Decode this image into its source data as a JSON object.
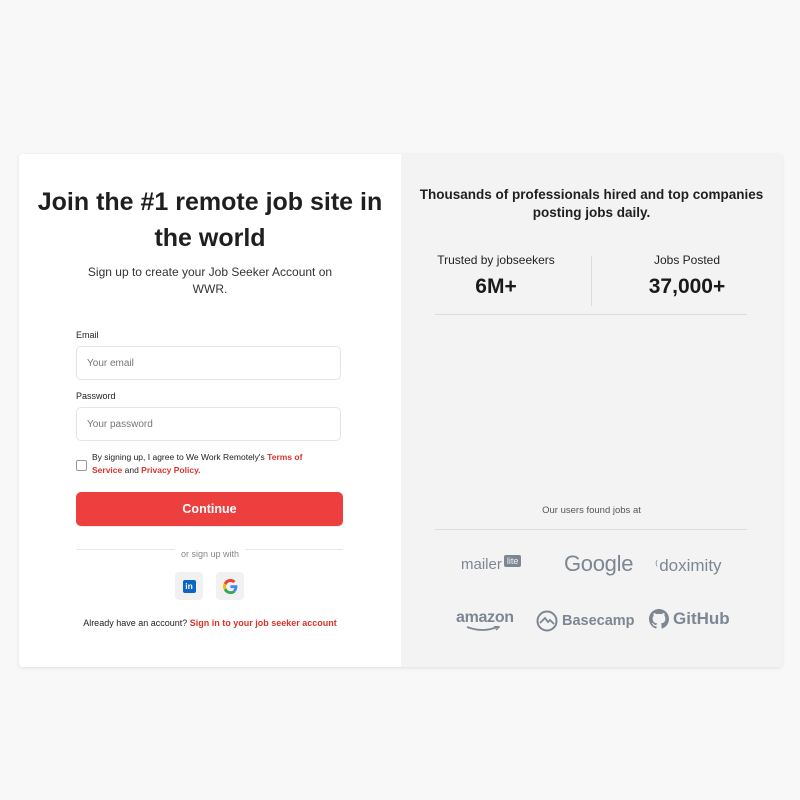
{
  "form": {
    "title": "Join the #1 remote job site in the world",
    "subtitle": "Sign up to create your Job Seeker Account on WWR.",
    "email_label": "Email",
    "email_placeholder": "Your email",
    "password_label": "Password",
    "password_placeholder": "Your password",
    "agree_prefix": "By signing up, I agree to We Work Remotely's ",
    "terms_link": "Terms of Service",
    "agree_and": " and ",
    "privacy_link": "Privacy Policy.",
    "continue_label": "Continue",
    "or_text": "or sign up with",
    "signin_prefix": "Already have an account? ",
    "signin_link": "Sign in to your job seeker account"
  },
  "social": [
    {
      "name": "linkedin",
      "icon": "linkedin-icon",
      "glyph": "in",
      "color": "#0a66c2"
    },
    {
      "name": "google",
      "icon": "google-icon",
      "glyph": "G"
    }
  ],
  "promo": {
    "headline": "Thousands of professionals hired and top companies posting jobs daily.",
    "stats": [
      {
        "label": "Trusted by jobseekers",
        "value": "6M+"
      },
      {
        "label": "Jobs Posted",
        "value": "37,000+"
      }
    ],
    "found_text": "Our users found jobs at",
    "logos": [
      {
        "name": "mailerlite",
        "text": "mailer",
        "badge": "lite"
      },
      {
        "name": "google",
        "text": "Google"
      },
      {
        "name": "doximity",
        "text": "doximity"
      },
      {
        "name": "amazon",
        "text": "amazon"
      },
      {
        "name": "basecamp",
        "text": "Basecamp"
      },
      {
        "name": "github",
        "text": "GitHub"
      }
    ]
  },
  "colors": {
    "accent": "#ee3f3f",
    "link": "#d9342b",
    "panel": "#f3f3f3",
    "logo_gray": "#7d8794"
  }
}
